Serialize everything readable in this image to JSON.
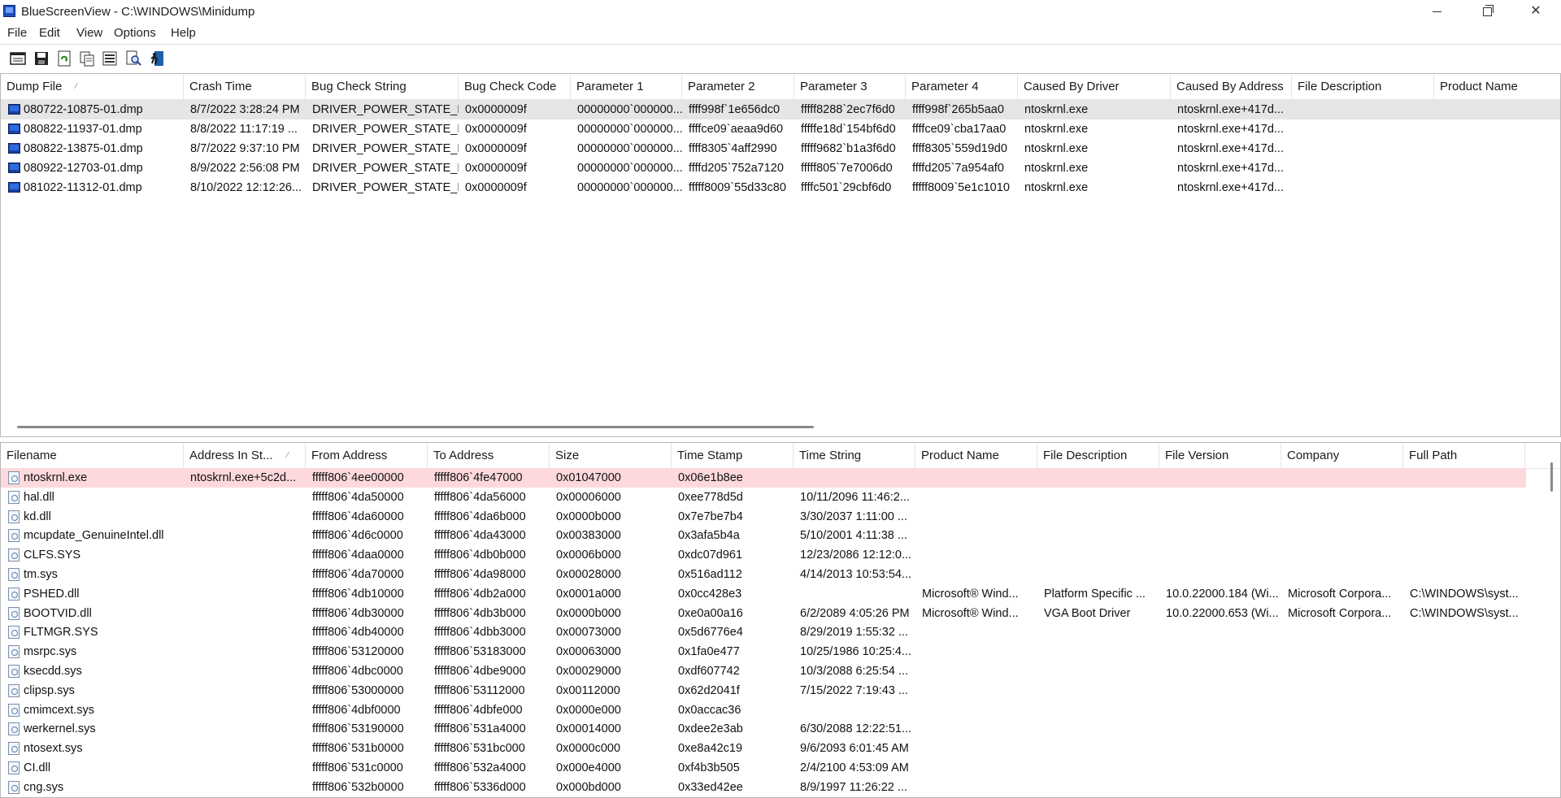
{
  "window": {
    "title": "BlueScreenView  -  C:\\WINDOWS\\Minidump",
    "minimize": "",
    "close": "✕"
  },
  "menu": [
    "File",
    "Edit",
    "View",
    "Options",
    "Help"
  ],
  "toolbar": [
    "html-report-icon",
    "save-icon",
    "refresh-icon",
    "copy-icon",
    "properties-icon",
    "find-icon",
    "exit-icon"
  ],
  "dumps": {
    "columns": [
      "Dump File",
      "Crash Time",
      "Bug Check String",
      "Bug Check Code",
      "Parameter 1",
      "Parameter 2",
      "Parameter 3",
      "Parameter 4",
      "Caused By Driver",
      "Caused By Address",
      "File Description",
      "Product Name"
    ],
    "sort_indicator": "⁄",
    "rows": [
      [
        "080722-10875-01.dmp",
        "8/7/2022 3:28:24 PM",
        "DRIVER_POWER_STATE_F...",
        "0x0000009f",
        "00000000`000000...",
        "ffff998f`1e656dc0",
        "fffff8288`2ec7f6d0",
        "ffff998f`265b5aa0",
        "ntoskrnl.exe",
        "ntoskrnl.exe+417d..."
      ],
      [
        "080822-11937-01.dmp",
        "8/8/2022 11:17:19 ...",
        "DRIVER_POWER_STATE_F...",
        "0x0000009f",
        "00000000`000000...",
        "ffffce09`aeaa9d60",
        "fffffe18d`154bf6d0",
        "ffffce09`cba17aa0",
        "ntoskrnl.exe",
        "ntoskrnl.exe+417d..."
      ],
      [
        "080822-13875-01.dmp",
        "8/7/2022 9:37:10 PM",
        "DRIVER_POWER_STATE_F...",
        "0x0000009f",
        "00000000`000000...",
        "ffff8305`4aff2990",
        "fffff9682`b1a3f6d0",
        "ffff8305`559d19d0",
        "ntoskrnl.exe",
        "ntoskrnl.exe+417d..."
      ],
      [
        "080922-12703-01.dmp",
        "8/9/2022 2:56:08 PM",
        "DRIVER_POWER_STATE_F...",
        "0x0000009f",
        "00000000`000000...",
        "ffffd205`752a7120",
        "fffff805`7e7006d0",
        "ffffd205`7a954af0",
        "ntoskrnl.exe",
        "ntoskrnl.exe+417d..."
      ],
      [
        "081022-11312-01.dmp",
        "8/10/2022 12:12:26...",
        "DRIVER_POWER_STATE_F...",
        "0x0000009f",
        "00000000`000000...",
        "fffff8009`55d33c80",
        "ffffc501`29cbf6d0",
        "fffff8009`5e1c1010",
        "ntoskrnl.exe",
        "ntoskrnl.exe+417d..."
      ]
    ]
  },
  "drivers": {
    "columns": [
      "Filename",
      "Address In St...",
      "From Address",
      "To Address",
      "Size",
      "Time Stamp",
      "Time String",
      "Product Name",
      "File Description",
      "File Version",
      "Company",
      "Full Path"
    ],
    "sort_indicator": "⁄",
    "rows": [
      [
        "ntoskrnl.exe",
        "ntoskrnl.exe+5c2d...",
        "fffff806`4ee00000",
        "fffff806`4fe47000",
        "0x01047000",
        "0x06e1b8ee",
        "",
        "",
        "",
        "",
        "",
        ""
      ],
      [
        "hal.dll",
        "",
        "fffff806`4da50000",
        "fffff806`4da56000",
        "0x00006000",
        "0xee778d5d",
        "10/11/2096 11:46:2...",
        "",
        "",
        "",
        "",
        ""
      ],
      [
        "kd.dll",
        "",
        "fffff806`4da60000",
        "fffff806`4da6b000",
        "0x0000b000",
        "0x7e7be7b4",
        "3/30/2037 1:11:00 ...",
        "",
        "",
        "",
        "",
        ""
      ],
      [
        "mcupdate_GenuineIntel.dll",
        "",
        "fffff806`4d6c0000",
        "fffff806`4da43000",
        "0x00383000",
        "0x3afa5b4a",
        "5/10/2001 4:11:38 ...",
        "",
        "",
        "",
        "",
        ""
      ],
      [
        "CLFS.SYS",
        "",
        "fffff806`4daa0000",
        "fffff806`4db0b000",
        "0x0006b000",
        "0xdc07d961",
        "12/23/2086 12:12:0...",
        "",
        "",
        "",
        "",
        ""
      ],
      [
        "tm.sys",
        "",
        "fffff806`4da70000",
        "fffff806`4da98000",
        "0x00028000",
        "0x516ad112",
        "4/14/2013 10:53:54...",
        "",
        "",
        "",
        "",
        ""
      ],
      [
        "PSHED.dll",
        "",
        "fffff806`4db10000",
        "fffff806`4db2a000",
        "0x0001a000",
        "0x0cc428e3",
        "",
        "Microsoft® Wind...",
        "Platform Specific ...",
        "10.0.22000.184 (Wi...",
        "Microsoft Corpora...",
        "C:\\WINDOWS\\syst..."
      ],
      [
        "BOOTVID.dll",
        "",
        "fffff806`4db30000",
        "fffff806`4db3b000",
        "0x0000b000",
        "0xe0a00a16",
        "6/2/2089 4:05:26 PM",
        "Microsoft® Wind...",
        "VGA Boot Driver",
        "10.0.22000.653 (Wi...",
        "Microsoft Corpora...",
        "C:\\WINDOWS\\syst..."
      ],
      [
        "FLTMGR.SYS",
        "",
        "fffff806`4db40000",
        "fffff806`4dbb3000",
        "0x00073000",
        "0x5d6776e4",
        "8/29/2019 1:55:32 ...",
        "",
        "",
        "",
        "",
        ""
      ],
      [
        "msrpc.sys",
        "",
        "fffff806`53120000",
        "fffff806`53183000",
        "0x00063000",
        "0x1fa0e477",
        "10/25/1986 10:25:4...",
        "",
        "",
        "",
        "",
        ""
      ],
      [
        "ksecdd.sys",
        "",
        "fffff806`4dbc0000",
        "fffff806`4dbe9000",
        "0x00029000",
        "0xdf607742",
        "10/3/2088 6:25:54 ...",
        "",
        "",
        "",
        "",
        ""
      ],
      [
        "clipsp.sys",
        "",
        "fffff806`53000000",
        "fffff806`53112000",
        "0x00112000",
        "0x62d2041f",
        "7/15/2022 7:19:43 ...",
        "",
        "",
        "",
        "",
        ""
      ],
      [
        "cmimcext.sys",
        "",
        "fffff806`4dbf0000",
        "fffff806`4dbfe000",
        "0x0000e000",
        "0x0accac36",
        "",
        "",
        "",
        "",
        "",
        ""
      ],
      [
        "werkernel.sys",
        "",
        "fffff806`53190000",
        "fffff806`531a4000",
        "0x00014000",
        "0xdee2e3ab",
        "6/30/2088 12:22:51...",
        "",
        "",
        "",
        "",
        ""
      ],
      [
        "ntosext.sys",
        "",
        "fffff806`531b0000",
        "fffff806`531bc000",
        "0x0000c000",
        "0xe8a42c19",
        "9/6/2093 6:01:45 AM",
        "",
        "",
        "",
        "",
        ""
      ],
      [
        "CI.dll",
        "",
        "fffff806`531c0000",
        "fffff806`532a4000",
        "0x000e4000",
        "0xf4b3b505",
        "2/4/2100 4:53:09 AM",
        "",
        "",
        "",
        "",
        ""
      ],
      [
        "cng.sys",
        "",
        "fffff806`532b0000",
        "fffff806`5336d000",
        "0x000bd000",
        "0x33ed42ee",
        "8/9/1997 11:26:22 ...",
        "",
        "",
        "",
        "",
        ""
      ]
    ]
  }
}
